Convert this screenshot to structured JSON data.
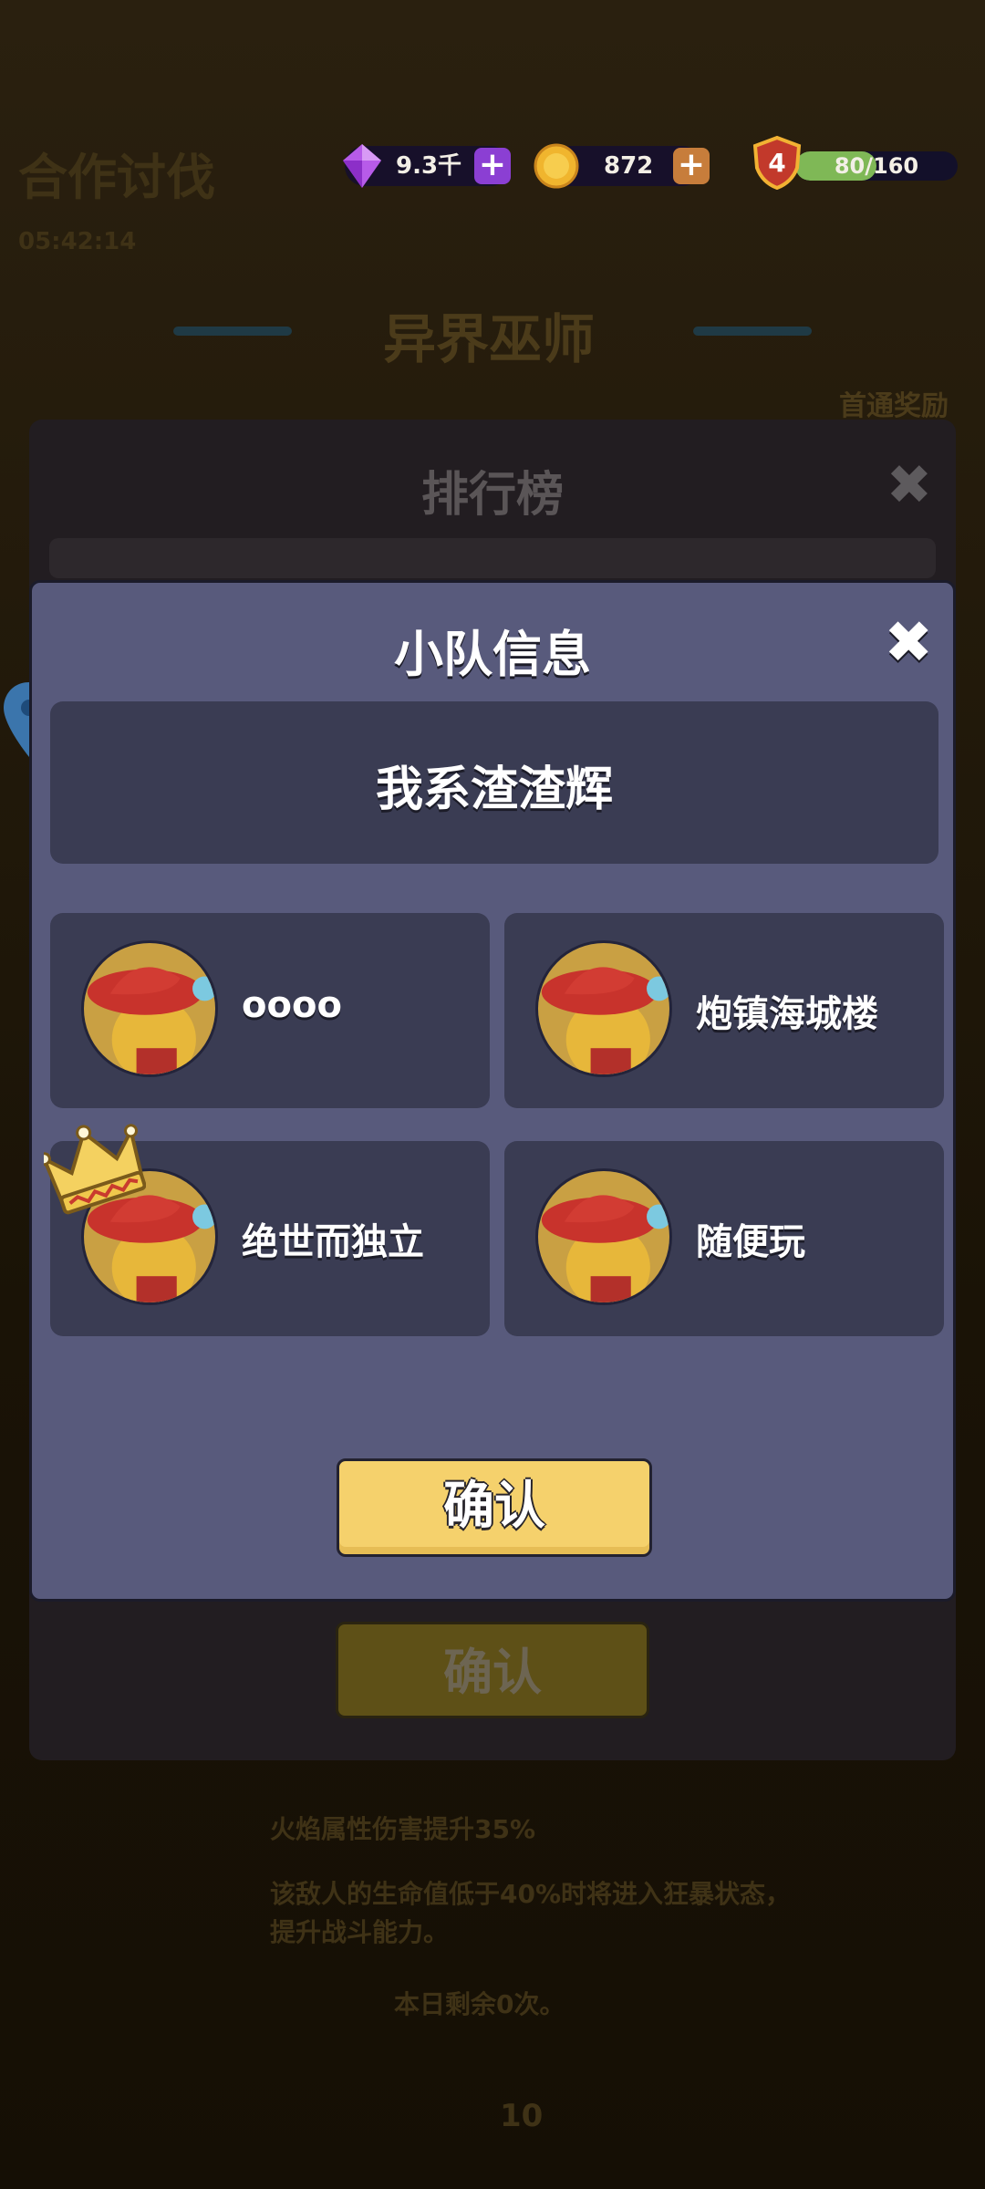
{
  "background": {
    "event_title": "合作讨伐",
    "event_timer": "05:42:14",
    "boss_name": "异界巫师",
    "first_reward": "首通奖励",
    "buff_line_1": "火焰属性伤害提升35%",
    "buff_line_2": "该敌人的生命值低于40%时将进入狂暴状态，提升战斗能力。",
    "remaining_today": "本日剩余0次。",
    "cost": "10"
  },
  "resources": {
    "gems": "9.3千",
    "coins": "872",
    "level": "4",
    "xp": "80/160",
    "xp_progress": 0.5
  },
  "leaderboard": {
    "title": "排行榜",
    "confirm_label": "确认"
  },
  "team_modal": {
    "title": "小队信息",
    "team_name": "我系渣渣辉",
    "members": [
      {
        "name": "oooo",
        "is_leader": false
      },
      {
        "name": "炮镇海城楼",
        "is_leader": false
      },
      {
        "name": "绝世而独立",
        "is_leader": true
      },
      {
        "name": "随便玩",
        "is_leader": false
      }
    ],
    "confirm_label": "确认"
  },
  "colors": {
    "modal_bg": "#585a7c",
    "card_bg": "#3a3c53",
    "confirm_yellow": "#f5d16c",
    "gem_purple": "#8b3fd3",
    "coin_orange": "#c77d3b",
    "xp_green": "#7fb856"
  },
  "icons": [
    "gem-icon",
    "coin-icon",
    "plus-icon",
    "level-shield-icon",
    "close-icon",
    "crown-icon",
    "map-pin-icon",
    "avatar-icon"
  ]
}
